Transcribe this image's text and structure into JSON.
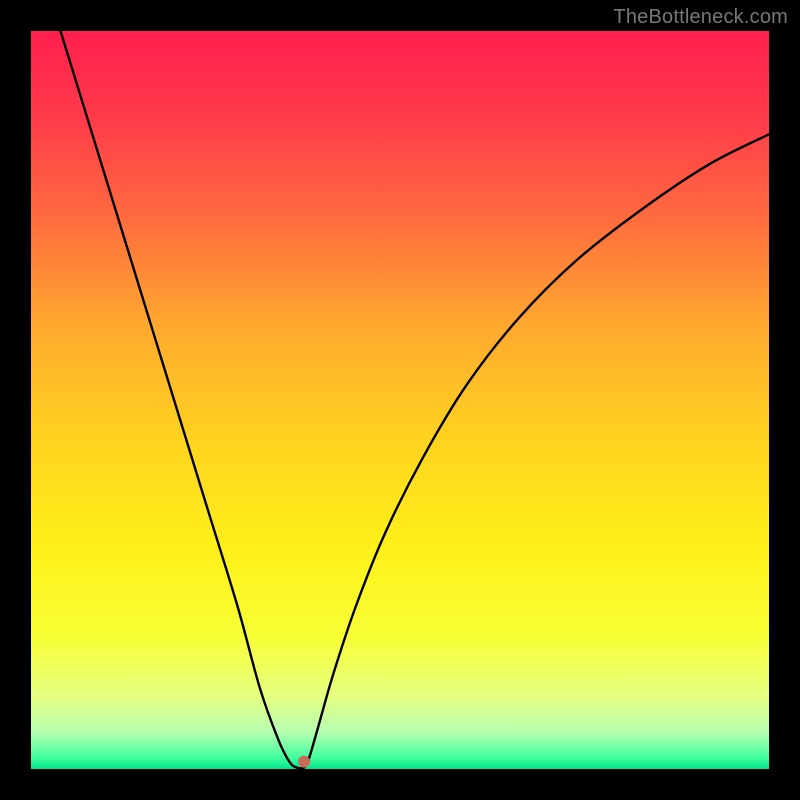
{
  "watermark": "TheBottleneck.com",
  "chart_data": {
    "type": "line",
    "title": "",
    "xlabel": "",
    "ylabel": "",
    "xlim": [
      0,
      100
    ],
    "ylim": [
      0,
      100
    ],
    "grid": false,
    "legend": false,
    "series": [
      {
        "name": "curve",
        "x": [
          4,
          8,
          12,
          16,
          20,
          24,
          28,
          31,
          33.5,
          35,
          36,
          37,
          37.5,
          38,
          39,
          41,
          44,
          48,
          53,
          59,
          66,
          74,
          83,
          92,
          100
        ],
        "y": [
          100,
          87,
          74,
          61,
          48,
          35,
          22,
          11,
          4,
          1,
          0.2,
          0.2,
          1,
          2.5,
          6,
          13,
          22,
          32,
          42,
          52,
          61,
          69,
          76,
          82,
          86
        ]
      }
    ],
    "marker": {
      "x": 37,
      "y": 1,
      "color": "#c96b5a",
      "r": 6
    },
    "gradient_stops": [
      {
        "offset": 0.0,
        "color": "#ff1f4f"
      },
      {
        "offset": 0.12,
        "color": "#ff3b4a"
      },
      {
        "offset": 0.25,
        "color": "#ff6a3f"
      },
      {
        "offset": 0.4,
        "color": "#ffa92f"
      },
      {
        "offset": 0.55,
        "color": "#ffd21f"
      },
      {
        "offset": 0.7,
        "color": "#fff019"
      },
      {
        "offset": 0.82,
        "color": "#f7ff35"
      },
      {
        "offset": 0.9,
        "color": "#e6ff80"
      },
      {
        "offset": 0.95,
        "color": "#b7ffb0"
      },
      {
        "offset": 0.985,
        "color": "#3fff9e"
      },
      {
        "offset": 1.0,
        "color": "#00e58a"
      }
    ]
  }
}
